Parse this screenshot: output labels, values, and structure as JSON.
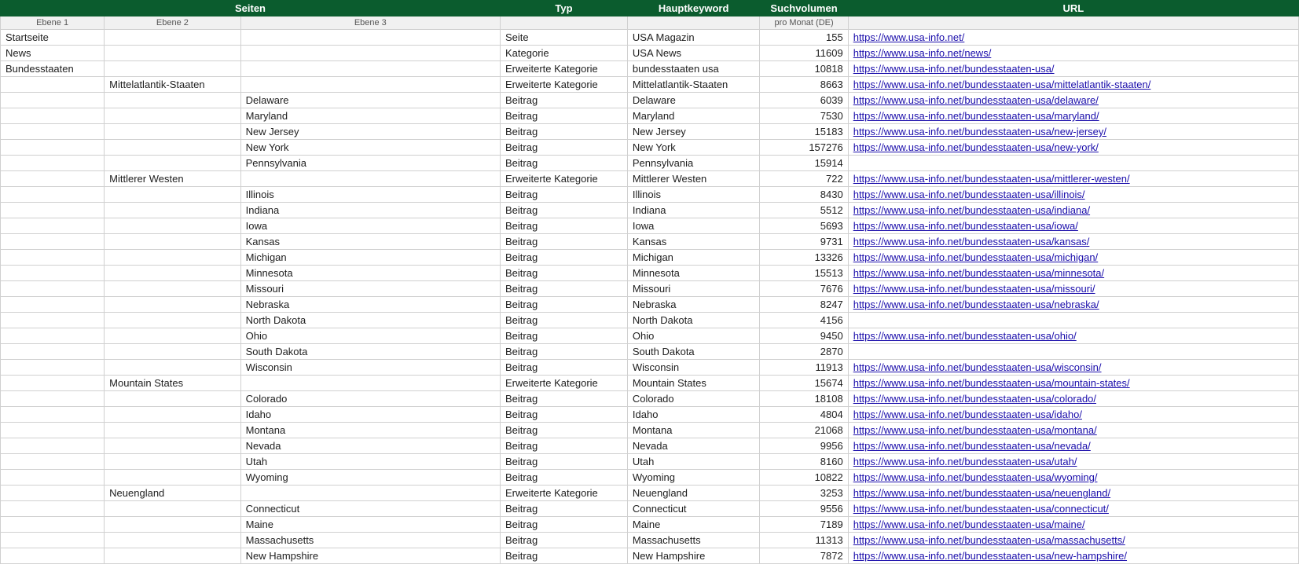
{
  "header": {
    "seiten": "Seiten",
    "typ": "Typ",
    "hauptkeyword": "Hauptkeyword",
    "suchvolumen": "Suchvolumen",
    "url": "URL"
  },
  "subheader": {
    "ebene1": "Ebene 1",
    "ebene2": "Ebene 2",
    "ebene3": "Ebene 3",
    "blank": "",
    "promonat": "pro Monat (DE)"
  },
  "rows": [
    {
      "e1": "Startseite",
      "e2": "",
      "e3": "",
      "typ": "Seite",
      "kw": "USA Magazin",
      "vol": "155",
      "url": "https://www.usa-info.net/"
    },
    {
      "e1": "News",
      "e2": "",
      "e3": "",
      "typ": "Kategorie",
      "kw": "USA News",
      "vol": "11609",
      "url": "https://www.usa-info.net/news/"
    },
    {
      "e1": "Bundesstaaten",
      "e2": "",
      "e3": "",
      "typ": "Erweiterte Kategorie",
      "kw": "bundesstaaten usa",
      "vol": "10818",
      "url": "https://www.usa-info.net/bundesstaaten-usa/"
    },
    {
      "e1": "",
      "e2": "Mittelatlantik-Staaten",
      "e3": "",
      "typ": "Erweiterte Kategorie",
      "kw": "Mittelatlantik-Staaten",
      "vol": "8663",
      "url": "https://www.usa-info.net/bundesstaaten-usa/mittelatlantik-staaten/"
    },
    {
      "e1": "",
      "e2": "",
      "e3": "Delaware",
      "typ": "Beitrag",
      "kw": "Delaware",
      "vol": "6039",
      "url": "https://www.usa-info.net/bundesstaaten-usa/delaware/"
    },
    {
      "e1": "",
      "e2": "",
      "e3": "Maryland",
      "typ": "Beitrag",
      "kw": "Maryland",
      "vol": "7530",
      "url": "https://www.usa-info.net/bundesstaaten-usa/maryland/"
    },
    {
      "e1": "",
      "e2": "",
      "e3": "New Jersey",
      "typ": "Beitrag",
      "kw": "New Jersey",
      "vol": "15183",
      "url": "https://www.usa-info.net/bundesstaaten-usa/new-jersey/"
    },
    {
      "e1": "",
      "e2": "",
      "e3": "New York",
      "typ": "Beitrag",
      "kw": "New York",
      "vol": "157276",
      "url": "https://www.usa-info.net/bundesstaaten-usa/new-york/"
    },
    {
      "e1": "",
      "e2": "",
      "e3": "Pennsylvania",
      "typ": "Beitrag",
      "kw": "Pennsylvania",
      "vol": "15914",
      "url": ""
    },
    {
      "e1": "",
      "e2": "Mittlerer Westen",
      "e3": "",
      "typ": "Erweiterte Kategorie",
      "kw": "Mittlerer Westen",
      "vol": "722",
      "url": "https://www.usa-info.net/bundesstaaten-usa/mittlerer-westen/"
    },
    {
      "e1": "",
      "e2": "",
      "e3": "Illinois",
      "typ": "Beitrag",
      "kw": "Illinois",
      "vol": "8430",
      "url": "https://www.usa-info.net/bundesstaaten-usa/illinois/"
    },
    {
      "e1": "",
      "e2": "",
      "e3": "Indiana",
      "typ": "Beitrag",
      "kw": "Indiana",
      "vol": "5512",
      "url": "https://www.usa-info.net/bundesstaaten-usa/indiana/"
    },
    {
      "e1": "",
      "e2": "",
      "e3": "Iowa",
      "typ": "Beitrag",
      "kw": "Iowa",
      "vol": "5693",
      "url": "https://www.usa-info.net/bundesstaaten-usa/iowa/"
    },
    {
      "e1": "",
      "e2": "",
      "e3": "Kansas",
      "typ": "Beitrag",
      "kw": "Kansas",
      "vol": "9731",
      "url": "https://www.usa-info.net/bundesstaaten-usa/kansas/"
    },
    {
      "e1": "",
      "e2": "",
      "e3": "Michigan",
      "typ": "Beitrag",
      "kw": "Michigan",
      "vol": "13326",
      "url": "https://www.usa-info.net/bundesstaaten-usa/michigan/"
    },
    {
      "e1": "",
      "e2": "",
      "e3": "Minnesota",
      "typ": "Beitrag",
      "kw": "Minnesota",
      "vol": "15513",
      "url": "https://www.usa-info.net/bundesstaaten-usa/minnesota/"
    },
    {
      "e1": "",
      "e2": "",
      "e3": "Missouri",
      "typ": "Beitrag",
      "kw": "Missouri",
      "vol": "7676",
      "url": "https://www.usa-info.net/bundesstaaten-usa/missouri/"
    },
    {
      "e1": "",
      "e2": "",
      "e3": "Nebraska",
      "typ": "Beitrag",
      "kw": "Nebraska",
      "vol": "8247",
      "url": "https://www.usa-info.net/bundesstaaten-usa/nebraska/"
    },
    {
      "e1": "",
      "e2": "",
      "e3": "North Dakota",
      "typ": "Beitrag",
      "kw": "North Dakota",
      "vol": "4156",
      "url": ""
    },
    {
      "e1": "",
      "e2": "",
      "e3": "Ohio",
      "typ": "Beitrag",
      "kw": "Ohio",
      "vol": "9450",
      "url": "https://www.usa-info.net/bundesstaaten-usa/ohio/"
    },
    {
      "e1": "",
      "e2": "",
      "e3": "South Dakota",
      "typ": "Beitrag",
      "kw": "South Dakota",
      "vol": "2870",
      "url": ""
    },
    {
      "e1": "",
      "e2": "",
      "e3": "Wisconsin",
      "typ": "Beitrag",
      "kw": "Wisconsin",
      "vol": "11913",
      "url": "https://www.usa-info.net/bundesstaaten-usa/wisconsin/"
    },
    {
      "e1": "",
      "e2": "Mountain States",
      "e3": "",
      "typ": "Erweiterte Kategorie",
      "kw": "Mountain States",
      "vol": "15674",
      "url": "https://www.usa-info.net/bundesstaaten-usa/mountain-states/"
    },
    {
      "e1": "",
      "e2": "",
      "e3": "Colorado",
      "typ": "Beitrag",
      "kw": "Colorado",
      "vol": "18108",
      "url": "https://www.usa-info.net/bundesstaaten-usa/colorado/"
    },
    {
      "e1": "",
      "e2": "",
      "e3": "Idaho",
      "typ": "Beitrag",
      "kw": "Idaho",
      "vol": "4804",
      "url": "https://www.usa-info.net/bundesstaaten-usa/idaho/"
    },
    {
      "e1": "",
      "e2": "",
      "e3": "Montana",
      "typ": "Beitrag",
      "kw": "Montana",
      "vol": "21068",
      "url": "https://www.usa-info.net/bundesstaaten-usa/montana/"
    },
    {
      "e1": "",
      "e2": "",
      "e3": "Nevada",
      "typ": "Beitrag",
      "kw": "Nevada",
      "vol": "9956",
      "url": "https://www.usa-info.net/bundesstaaten-usa/nevada/"
    },
    {
      "e1": "",
      "e2": "",
      "e3": "Utah",
      "typ": "Beitrag",
      "kw": "Utah",
      "vol": "8160",
      "url": "https://www.usa-info.net/bundesstaaten-usa/utah/"
    },
    {
      "e1": "",
      "e2": "",
      "e3": "Wyoming",
      "typ": "Beitrag",
      "kw": "Wyoming",
      "vol": "10822",
      "url": "https://www.usa-info.net/bundesstaaten-usa/wyoming/"
    },
    {
      "e1": "",
      "e2": "Neuengland",
      "e3": "",
      "typ": "Erweiterte Kategorie",
      "kw": "Neuengland",
      "vol": "3253",
      "url": "https://www.usa-info.net/bundesstaaten-usa/neuengland/"
    },
    {
      "e1": "",
      "e2": "",
      "e3": "Connecticut",
      "typ": "Beitrag",
      "kw": "Connecticut",
      "vol": "9556",
      "url": "https://www.usa-info.net/bundesstaaten-usa/connecticut/"
    },
    {
      "e1": "",
      "e2": "",
      "e3": "Maine",
      "typ": "Beitrag",
      "kw": "Maine",
      "vol": "7189",
      "url": "https://www.usa-info.net/bundesstaaten-usa/maine/"
    },
    {
      "e1": "",
      "e2": "",
      "e3": "Massachusetts",
      "typ": "Beitrag",
      "kw": "Massachusetts",
      "vol": "11313",
      "url": "https://www.usa-info.net/bundesstaaten-usa/massachusetts/"
    },
    {
      "e1": "",
      "e2": "",
      "e3": "New Hampshire",
      "typ": "Beitrag",
      "kw": "New Hampshire",
      "vol": "7872",
      "url": "https://www.usa-info.net/bundesstaaten-usa/new-hampshire/"
    }
  ]
}
